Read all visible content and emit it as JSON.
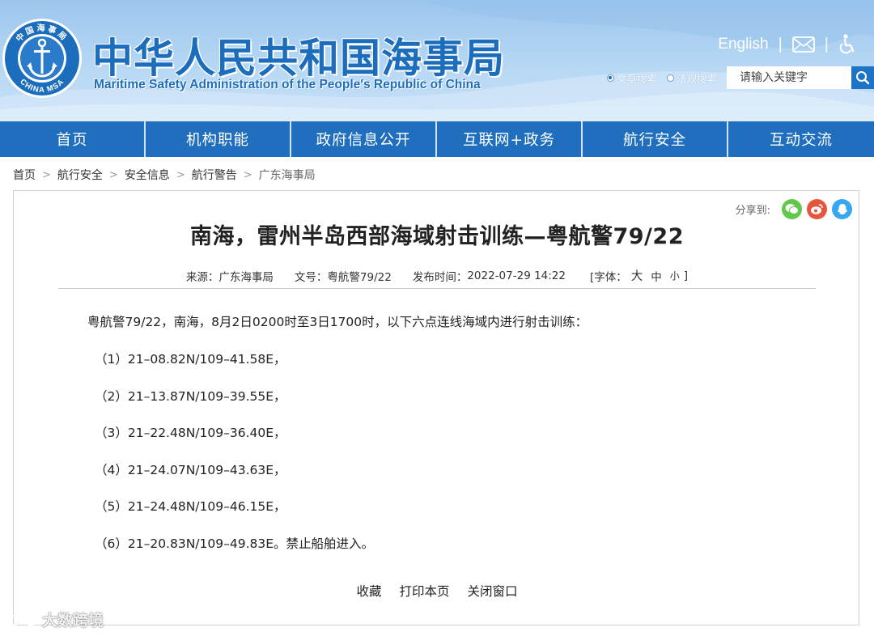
{
  "header": {
    "title_cn": "中华人民共和国海事局",
    "title_en": "Maritime Safety Administration of the People's Republic of China",
    "logo_text_top": "中国海事局",
    "logo_text_bottom": "CHINA MSA",
    "english_link": "English",
    "separator": "|",
    "search": {
      "option_text": "文章搜索",
      "option_law": "法规搜索",
      "placeholder": "请输入关键字",
      "selected": "文章搜索"
    },
    "colors": {
      "header_bg": "#b6d7f4",
      "title": "#1d6dbd"
    }
  },
  "nav": {
    "items": [
      "首页",
      "机构职能",
      "政府信息公开",
      "互联网+政务",
      "航行安全",
      "互动交流"
    ],
    "color": "#1f6fbe"
  },
  "breadcrumb": [
    "首页",
    "航行安全",
    "安全信息",
    "航行警告",
    "广东海事局"
  ],
  "article": {
    "share_label": "分享到:",
    "share_icons": [
      "wechat-icon",
      "weibo-icon",
      "qq-icon"
    ],
    "title": "南海，雷州半岛西部海域射击训练—粤航警79/22",
    "meta": {
      "source_label": "来源：",
      "source": "广东海事局",
      "doc_label": "文号：",
      "doc_no": "粤航警79/22",
      "date_label": "发布时间：",
      "date": "2022-07-29 14:22",
      "font_label": "[字体：",
      "font_big": "大",
      "font_mid": "中",
      "font_small": "小",
      "font_close": "]"
    },
    "intro": "粤航警79/22，南海，8月2日0200时至3日1700时，以下六点连线海域内进行射击训练：",
    "coordinates": [
      "（1）21–08.82N/109–41.58E，",
      "（2）21–13.87N/109–39.55E，",
      "（3）21–22.48N/109–36.40E，",
      "（4）21–24.07N/109–43.63E，",
      "（5）21–24.48N/109–46.15E，",
      "（6）21–20.83N/109–49.83E。禁止船舶进入。"
    ],
    "actions": [
      "收藏",
      "打印本页",
      "关闭窗口"
    ]
  },
  "watermark": "大数跨境"
}
